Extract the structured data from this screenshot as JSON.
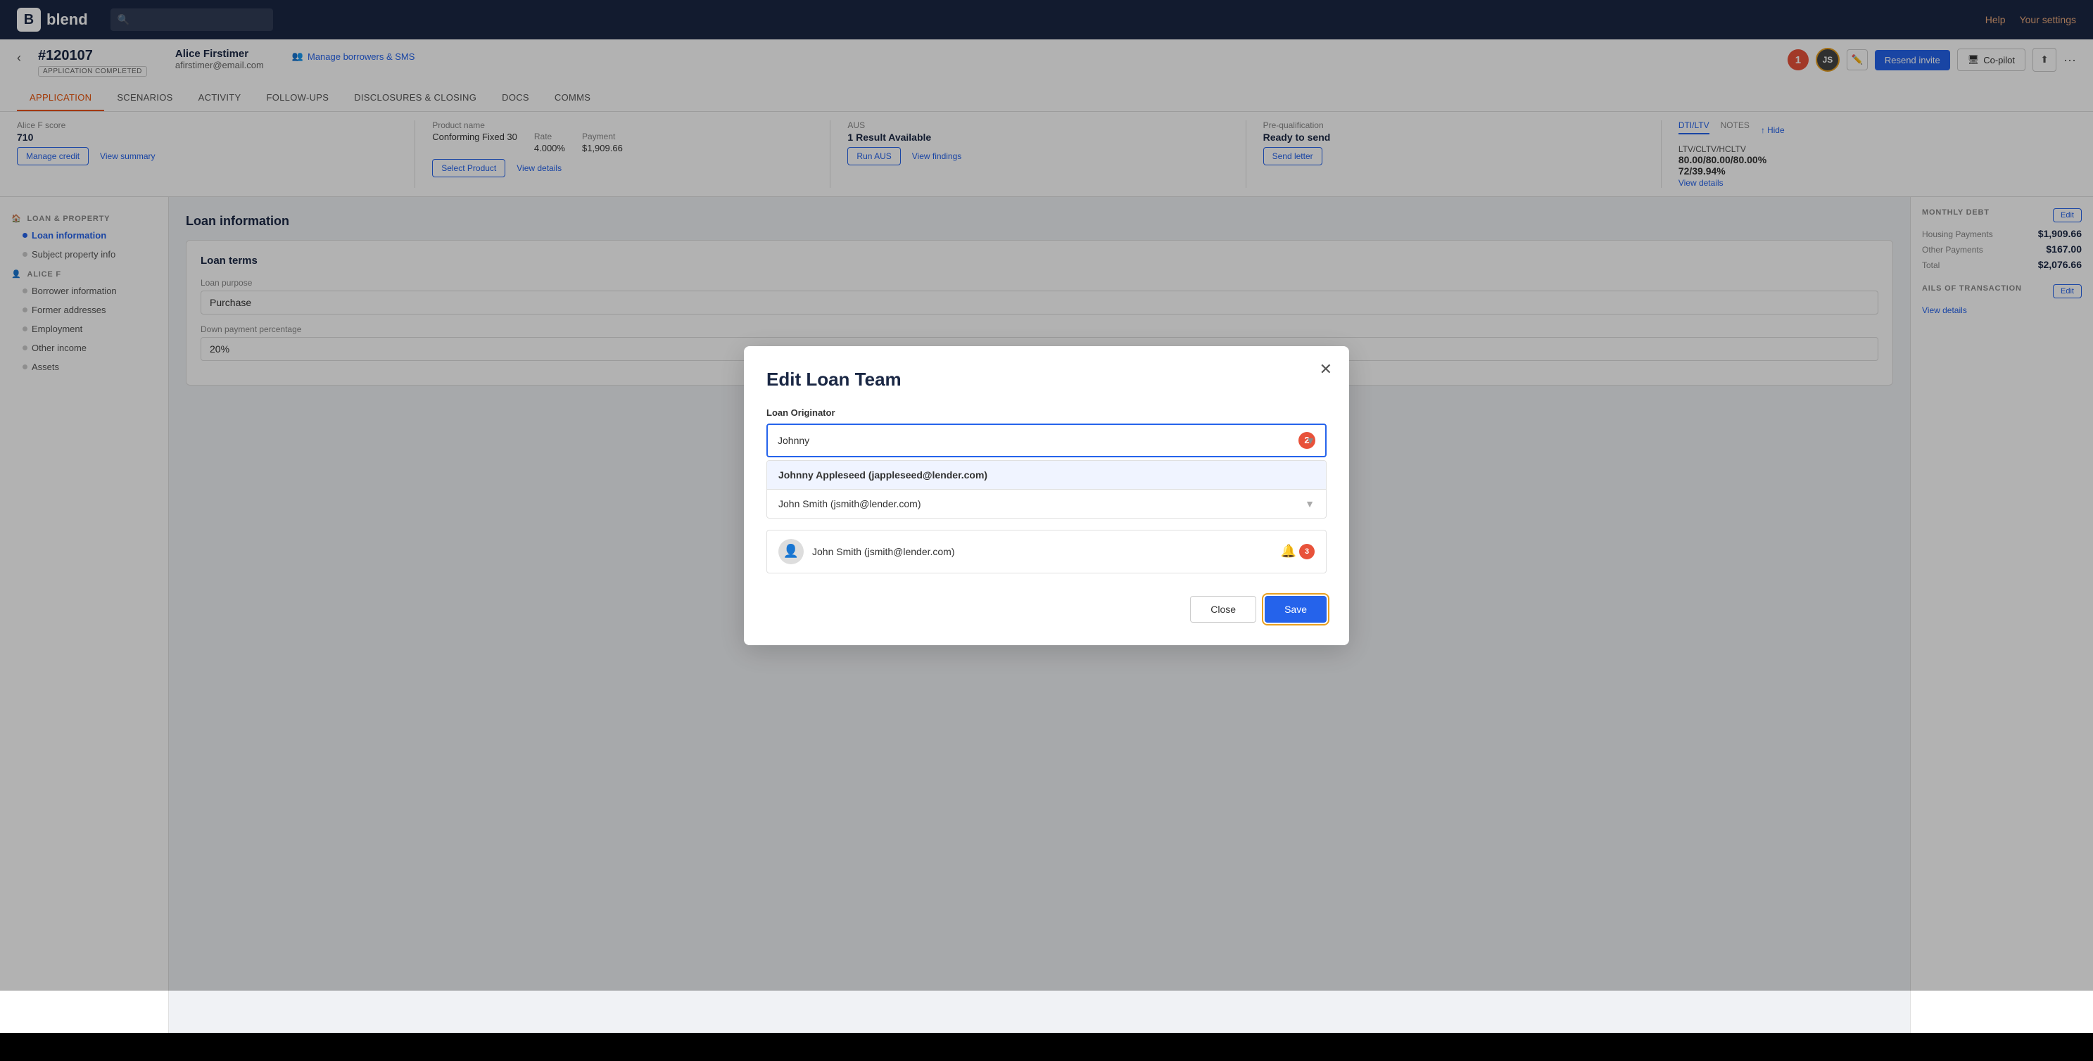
{
  "nav": {
    "logo_text": "blend",
    "help_label": "Help",
    "settings_label": "Your settings",
    "search_placeholder": ""
  },
  "header": {
    "app_id": "#120107",
    "app_status": "APPLICATION COMPLETED",
    "borrower_name": "Alice Firstimer",
    "borrower_email": "afirstimer@email.com",
    "manage_borrowers_label": "Manage borrowers & SMS",
    "badge_number": "1",
    "avatar_initials": "JS",
    "resend_invite_label": "Resend invite",
    "copilot_label": "Co-pilot",
    "more_label": "···"
  },
  "tabs": [
    {
      "label": "APPLICATION",
      "active": true
    },
    {
      "label": "SCENARIOS",
      "active": false
    },
    {
      "label": "ACTIVITY",
      "active": false
    },
    {
      "label": "FOLLOW-UPS",
      "active": false
    },
    {
      "label": "DISCLOSURES & CLOSING",
      "active": false
    },
    {
      "label": "DOCS",
      "active": false
    },
    {
      "label": "COMMS",
      "active": false
    }
  ],
  "info_bar": {
    "credit": {
      "label": "Alice F score",
      "value": "710",
      "manage_credit": "Manage credit",
      "view_summary": "View summary"
    },
    "product": {
      "label": "Product name",
      "value": "Conforming Fixed 30",
      "rate_label": "Rate",
      "rate_value": "4.000%",
      "payment_label": "Payment",
      "payment_value": "$1,909.66",
      "select_product": "Select Product",
      "view_details": "View details"
    },
    "aus": {
      "label": "AUS",
      "value": "1 Result Available",
      "run_aus": "Run AUS",
      "view_findings": "View findings"
    },
    "prequalification": {
      "label": "Pre-qualification",
      "value": "Ready to send",
      "send_letter": "Send letter"
    },
    "hide_label": "Hide",
    "dti_tab": "DTI/LTV",
    "notes_tab": "NOTES",
    "ltv_label": "LTV/CLTV/HCLTV",
    "ltv_value": "80.00/80.00/80.00%",
    "dti_value": "72/39.94%",
    "view_details_link": "View details"
  },
  "sidebar": {
    "loan_property_title": "LOAN & PROPERTY",
    "items_loan": [
      {
        "label": "Loan information",
        "active": true
      },
      {
        "label": "Subject property info",
        "active": false
      }
    ],
    "alice_title": "ALICE F",
    "items_alice": [
      {
        "label": "Borrower information",
        "active": false
      },
      {
        "label": "Former addresses",
        "active": false
      },
      {
        "label": "Employment",
        "active": false
      },
      {
        "label": "Other income",
        "active": false
      },
      {
        "label": "Assets",
        "active": false
      }
    ]
  },
  "content": {
    "section_title": "Loan information",
    "card_title": "Loan terms",
    "loan_purpose_label": "Loan purpose",
    "loan_purpose_value": "Purchase",
    "down_payment_label": "Down payment percentage",
    "down_payment_value": "20%"
  },
  "right_panel": {
    "monthly_debt_title": "MONTHLY DEBT",
    "housing_payments_label": "Housing Payments",
    "housing_payments_value": "$1,909.66",
    "other_payments_label": "Other Payments",
    "other_payments_value": "$167.00",
    "total_label": "Total",
    "total_value": "$2,076.66",
    "transaction_title": "AILS OF TRANSACTION",
    "view_details_label": "View details"
  },
  "modal": {
    "title": "Edit Loan Team",
    "originator_label": "Loan Originator",
    "search_value": "Johnny",
    "dropdown_items": [
      {
        "label": "Johnny Appleseed (jappleseed@lender.com)",
        "highlight": "Johnny",
        "highlighted": true
      },
      {
        "label": "John Smith (jsmith@lender.com)",
        "highlighted": false
      }
    ],
    "person_row": {
      "name": "John Smith (jsmith@lender.com)",
      "bell_badge": "3"
    },
    "close_label": "Close",
    "save_label": "Save",
    "badge_2": "2",
    "badge_3": "3"
  }
}
